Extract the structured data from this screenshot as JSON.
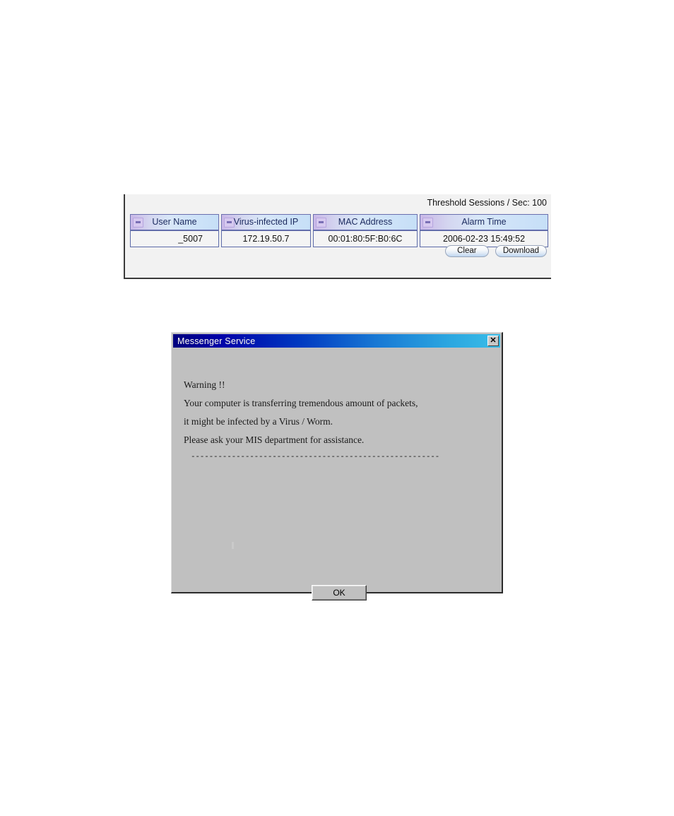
{
  "alarm_panel": {
    "threshold_label": "Threshold Sessions / Sec: 100",
    "table": {
      "columns": [
        "User Name",
        "Virus-infected IP",
        "MAC Address",
        "Alarm Time"
      ],
      "rows": [
        {
          "user_name": "_5007",
          "virus_infected_ip": "172.19.50.7",
          "mac_address": "00:01:80:5F:B0:6C",
          "alarm_time": "2006-02-23 15:49:52"
        }
      ]
    },
    "buttons": {
      "clear": "Clear",
      "download": "Download"
    }
  },
  "messenger_dialog": {
    "title": "Messenger Service",
    "close_glyph": "✕",
    "message_lines": [
      "Warning !!",
      "Your computer is transferring tremendous amount of packets,",
      "it might be infected by a Virus / Worm.",
      "Please ask your MIS department for assistance.",
      "-------------------------------------------------------"
    ],
    "ok_label": "OK"
  },
  "colors": {
    "titlebar_start": "#00007e",
    "titlebar_end": "#39bde8",
    "dialog_face": "#c0c0c0",
    "table_header_left": "#c9b8e8",
    "table_header_right": "#c6dff7",
    "table_border": "#5c6aa8"
  }
}
